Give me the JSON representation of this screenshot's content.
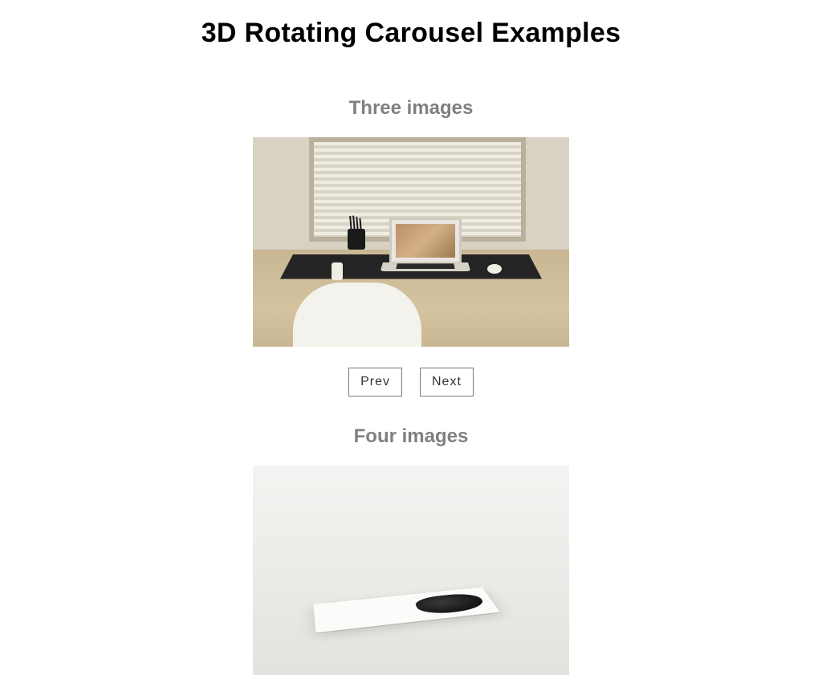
{
  "page_title": "3D Rotating Carousel Examples",
  "sections": [
    {
      "heading": "Three images",
      "image_semantic": "desk-workspace-with-laptop",
      "controls": {
        "prev": "Prev",
        "next": "Next"
      }
    },
    {
      "heading": "Four images",
      "image_semantic": "book-on-white-surface"
    }
  ]
}
